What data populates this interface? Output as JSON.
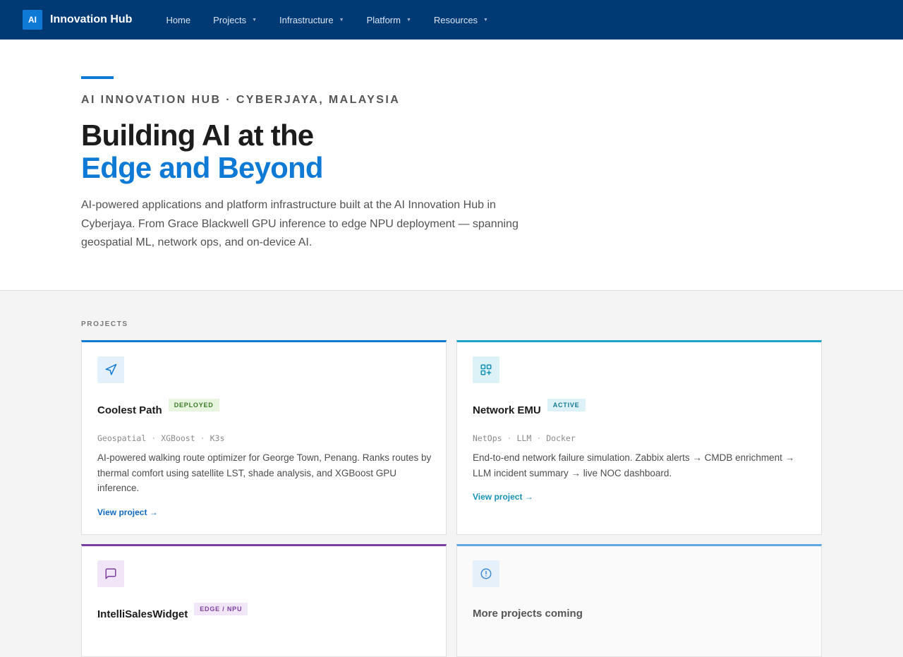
{
  "nav": {
    "logo_text": "AI",
    "brand": "Innovation Hub",
    "items": [
      {
        "label": "Home",
        "dropdown": false
      },
      {
        "label": "Projects",
        "dropdown": true
      },
      {
        "label": "Infrastructure",
        "dropdown": true
      },
      {
        "label": "Platform",
        "dropdown": true
      },
      {
        "label": "Resources",
        "dropdown": true
      }
    ],
    "caret": "▼"
  },
  "hero": {
    "eyebrow": "AI Innovation Hub · Cyberjaya, Malaysia",
    "title_line1": "Building AI at the",
    "title_line2": "Edge and Beyond",
    "lead": "AI-powered applications and platform infrastructure built at the AI Innovation Hub in Cyberjaya. From Grace Blackwell GPU inference to edge NPU deployment — spanning geospatial ML, network ops, and on-device AI."
  },
  "projects": {
    "label": "PROJECTS",
    "cards": [
      {
        "icon": "navigation-arrow-icon",
        "title": "Coolest Path",
        "badge": "DEPLOYED",
        "tags": [
          "Geospatial",
          "XGBoost",
          "K3s"
        ],
        "description": "AI-powered walking route optimizer for George Town, Penang. Ranks routes by thermal comfort using satellite LST, shade analysis, and XGBoost GPU inference.",
        "link": "View project →",
        "accent": "#0f7ad6"
      },
      {
        "icon": "network-grid-icon",
        "title": "Network EMU",
        "badge": "ACTIVE",
        "tags": [
          "NetOps",
          "LLM",
          "Docker"
        ],
        "description": "End-to-end network failure simulation. Zabbix alerts → CMDB enrichment → LLM incident summary → live NOC dashboard.",
        "link": "View project →",
        "accent": "#1da3c8"
      },
      {
        "icon": "chat-bubble-icon",
        "title": "IntelliSalesWidget",
        "badge": "EDGE / NPU",
        "accent": "#7b3fa0"
      },
      {
        "icon": "info-circle-icon",
        "title": "More projects coming",
        "accent": "#5fa6e3"
      }
    ]
  }
}
